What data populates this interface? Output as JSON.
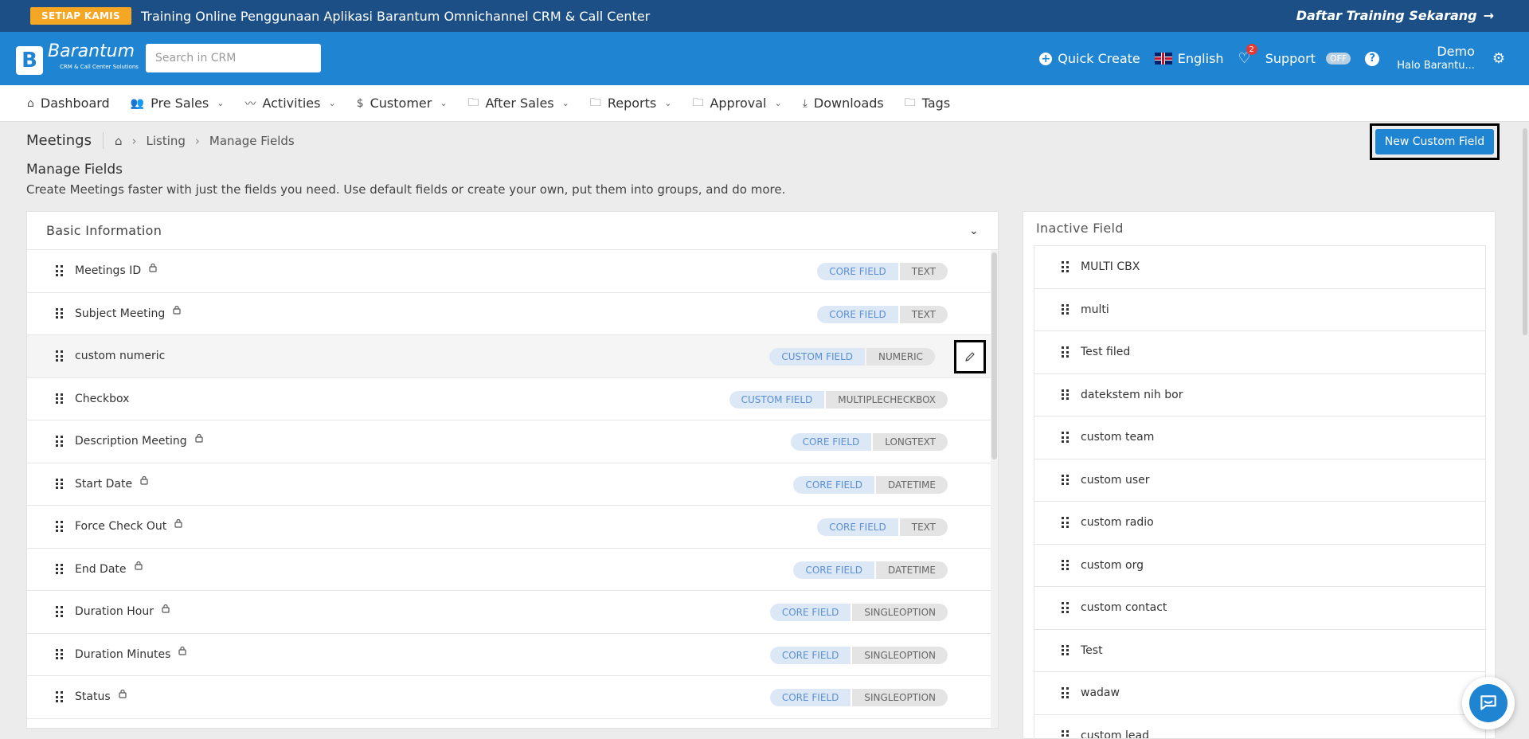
{
  "promo": {
    "badge": "SETIAP KAMIS",
    "text": "Training Online Penggunaan Aplikasi Barantum Omnichannel CRM & Call Center",
    "cta": "Daftar Training Sekarang"
  },
  "header": {
    "logo_name": "Barantum",
    "logo_tagline": "CRM & Call Center Solutions",
    "search_placeholder": "Search in CRM",
    "quick_create": "Quick Create",
    "language": "English",
    "notification_count": "2",
    "support": "Support",
    "support_toggle": "OFF",
    "user_name": "Demo",
    "user_greeting": "Halo Barantu..."
  },
  "nav": [
    {
      "label": "Dashboard",
      "icon": "home-icon",
      "dropdown": false
    },
    {
      "label": "Pre Sales",
      "icon": "users-icon",
      "dropdown": true
    },
    {
      "label": "Activities",
      "icon": "activity-icon",
      "dropdown": true
    },
    {
      "label": "Customer",
      "icon": "dollar-icon",
      "dropdown": true
    },
    {
      "label": "After Sales",
      "icon": "folder-icon",
      "dropdown": true
    },
    {
      "label": "Reports",
      "icon": "folder-icon",
      "dropdown": true
    },
    {
      "label": "Approval",
      "icon": "folder-icon",
      "dropdown": true
    },
    {
      "label": "Downloads",
      "icon": "download-icon",
      "dropdown": false
    },
    {
      "label": "Tags",
      "icon": "folder-icon",
      "dropdown": false
    }
  ],
  "breadcrumb": {
    "module": "Meetings",
    "listing": "Listing",
    "current": "Manage Fields"
  },
  "new_custom_field_button": "New Custom Field",
  "page": {
    "title": "Manage Fields",
    "description": "Create Meetings faster with just the fields you need. Use default fields or create your own, put them into groups, and do more."
  },
  "basic_info": {
    "title": "Basic Information",
    "fields": [
      {
        "name": "Meetings ID",
        "locked": true,
        "kind": "CORE FIELD",
        "type": "TEXT"
      },
      {
        "name": "Subject Meeting",
        "locked": true,
        "kind": "CORE FIELD",
        "type": "TEXT"
      },
      {
        "name": "custom numeric",
        "locked": false,
        "kind": "CUSTOM FIELD",
        "type": "NUMERIC",
        "highlighted": true
      },
      {
        "name": "Checkbox",
        "locked": false,
        "kind": "CUSTOM FIELD",
        "type": "MULTIPLECHECKBOX"
      },
      {
        "name": "Description Meeting",
        "locked": true,
        "kind": "CORE FIELD",
        "type": "LONGTEXT"
      },
      {
        "name": "Start Date",
        "locked": true,
        "kind": "CORE FIELD",
        "type": "DATETIME"
      },
      {
        "name": "Force Check Out",
        "locked": true,
        "kind": "CORE FIELD",
        "type": "TEXT"
      },
      {
        "name": "End Date",
        "locked": true,
        "kind": "CORE FIELD",
        "type": "DATETIME"
      },
      {
        "name": "Duration Hour",
        "locked": true,
        "kind": "CORE FIELD",
        "type": "SINGLEOPTION"
      },
      {
        "name": "Duration Minutes",
        "locked": true,
        "kind": "CORE FIELD",
        "type": "SINGLEOPTION"
      },
      {
        "name": "Status",
        "locked": true,
        "kind": "CORE FIELD",
        "type": "SINGLEOPTION"
      }
    ]
  },
  "inactive": {
    "title": "Inactive Field",
    "fields": [
      "MULTI CBX",
      "multi",
      "Test filed",
      "datekstem nih bor",
      "custom team",
      "custom user",
      "custom radio",
      "custom org",
      "custom contact",
      "Test",
      "wadaw",
      "custom lead"
    ]
  },
  "colors": {
    "primary": "#1f84d1",
    "banner": "#1b4f86",
    "badge": "#f5a623"
  }
}
